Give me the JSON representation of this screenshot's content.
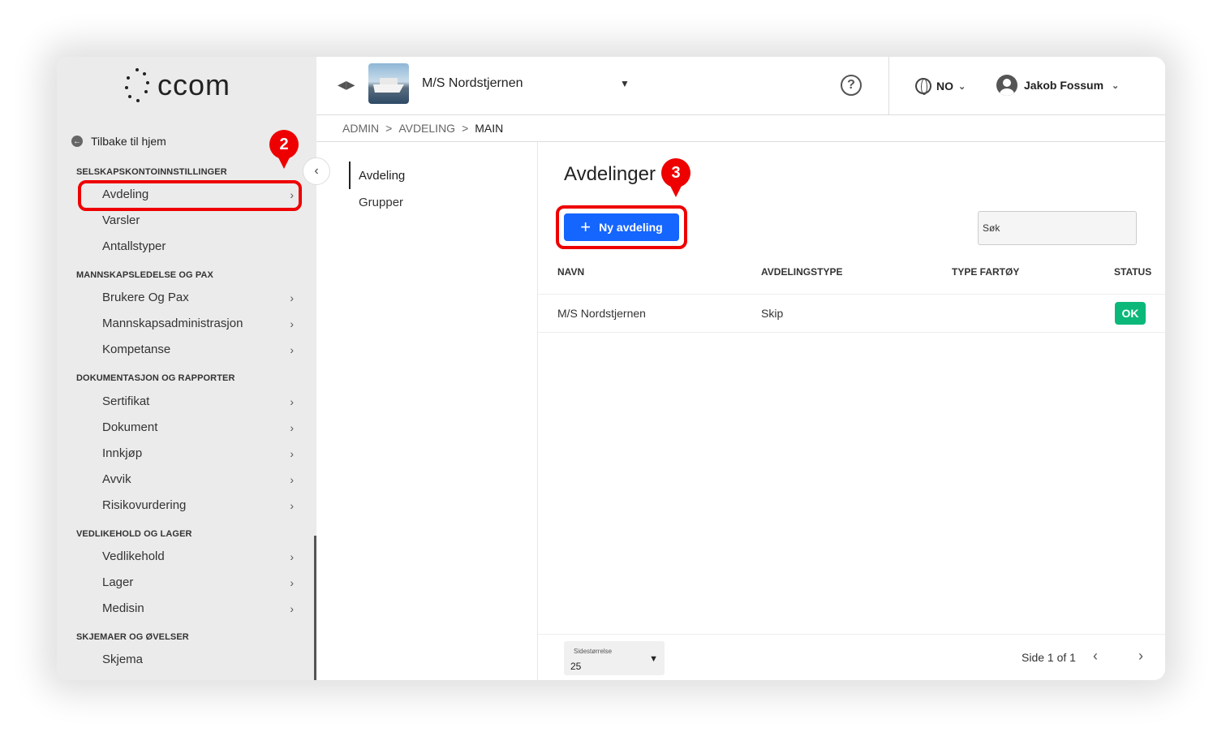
{
  "logo": {
    "text": "ccom"
  },
  "sidebar": {
    "back_label": "Tilbake til hjem",
    "sections": [
      {
        "title": "SELSKAPSKONTOINNSTILLINGER"
      },
      {
        "title": "MANNSKAPSLEDELSE OG PAX"
      },
      {
        "title": "DOKUMENTASJON OG RAPPORTER"
      },
      {
        "title": "VEDLIKEHOLD OG LAGER"
      },
      {
        "title": "SKJEMAER OG ØVELSER"
      }
    ],
    "items": [
      {
        "label": "Avdeling"
      },
      {
        "label": "Varsler"
      },
      {
        "label": "Antallstyper"
      },
      {
        "label": "Brukere Og Pax"
      },
      {
        "label": "Mannskapsadministrasjon"
      },
      {
        "label": "Kompetanse"
      },
      {
        "label": "Sertifikat"
      },
      {
        "label": "Dokument"
      },
      {
        "label": "Innkjøp"
      },
      {
        "label": "Avvik"
      },
      {
        "label": "Risikovurdering"
      },
      {
        "label": "Vedlikehold"
      },
      {
        "label": "Lager"
      },
      {
        "label": "Medisin"
      },
      {
        "label": "Skjema"
      }
    ],
    "chevron": "›"
  },
  "annotations": {
    "pin2": "2",
    "pin3": "3",
    "color": "#e00000"
  },
  "topbar": {
    "vessel_name": "M/S Nordstjernen",
    "language": "NO",
    "user_name": "Jakob Fossum",
    "help": "?"
  },
  "breadcrumb": {
    "items": [
      "ADMIN",
      "AVDELING",
      "MAIN"
    ],
    "separator": ">"
  },
  "subnav": {
    "items": [
      {
        "label": "Avdeling"
      },
      {
        "label": "Grupper"
      }
    ]
  },
  "main": {
    "title": "Avdelinger",
    "new_button_label": "Ny avdeling",
    "search_placeholder": "Søk",
    "columns": [
      "NAVN",
      "AVDELINGSTYPE",
      "TYPE FARTØY",
      "STATUS"
    ],
    "rows": [
      {
        "navn": "M/S Nordstjernen",
        "avdelingstype": "Skip",
        "type_fartoy": "",
        "status": "OK"
      }
    ],
    "page_size_label": "Sidestørrelse",
    "page_size_value": "25",
    "page_info": "Side 1 of 1",
    "accent": "#1565ff",
    "status_color": "#0bb87a"
  }
}
